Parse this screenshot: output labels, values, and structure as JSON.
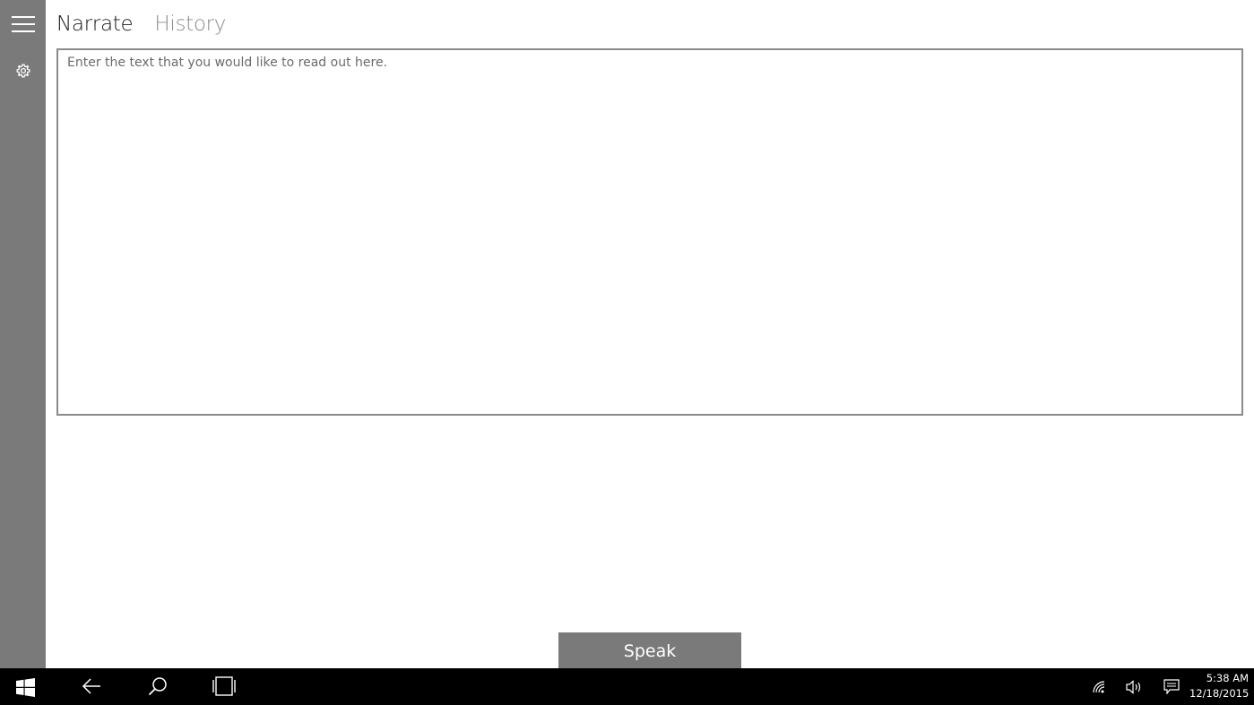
{
  "app": {
    "tabs": [
      {
        "label": "Narrate",
        "active": true
      },
      {
        "label": "History",
        "active": false
      }
    ],
    "textbox": {
      "placeholder": "Enter the text that you would like to read out here.",
      "value": ""
    },
    "speak_button": {
      "label": "Speak"
    },
    "sidebar": {
      "icons": [
        "hamburger-menu-icon",
        "settings-gear-icon"
      ],
      "color": "#7a7a7a"
    }
  },
  "taskbar": {
    "icons": [
      "windows-start-icon",
      "back-arrow-icon",
      "search-icon",
      "task-view-icon"
    ],
    "tray_icons": [
      "wifi-icon",
      "volume-icon",
      "action-center-icon"
    ],
    "time": "5:38 AM",
    "date": "12/18/2015"
  }
}
